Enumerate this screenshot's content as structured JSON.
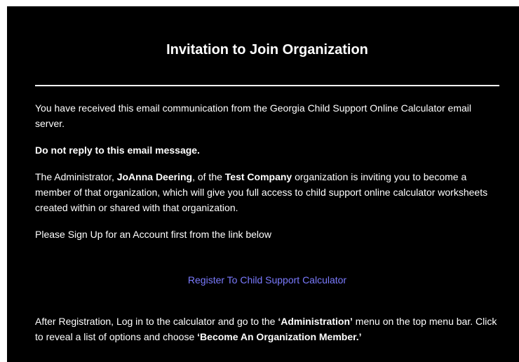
{
  "email": {
    "title": "Invitation to Join Organization",
    "intro": "You have received this email communication from the Georgia Child Support Online Calculator email server.",
    "no_reply": "Do not reply to this email message.",
    "invite": {
      "prefix": "The Administrator, ",
      "admin_name": "JoAnna Deering",
      "middle": ", of the ",
      "org_name": "Test Company",
      "suffix": " organization is inviting you to become a member of that organization, which will give you full access to child support online calculator worksheets created within or shared with that organization."
    },
    "signup_text": "Please Sign Up for an Account first from the link below",
    "register_link": "Register To Child Support Calculator",
    "after": {
      "prefix": "After Registration, Log in to the calculator and go to the ",
      "menu_name": "‘Administration’",
      "middle": " menu on the top menu bar. Click to reveal a list of options and choose ",
      "option_name": "‘Become An Organization Member.’"
    }
  },
  "colors": {
    "background": "#000000",
    "text": "#ffffff",
    "link": "#7b7bff"
  }
}
